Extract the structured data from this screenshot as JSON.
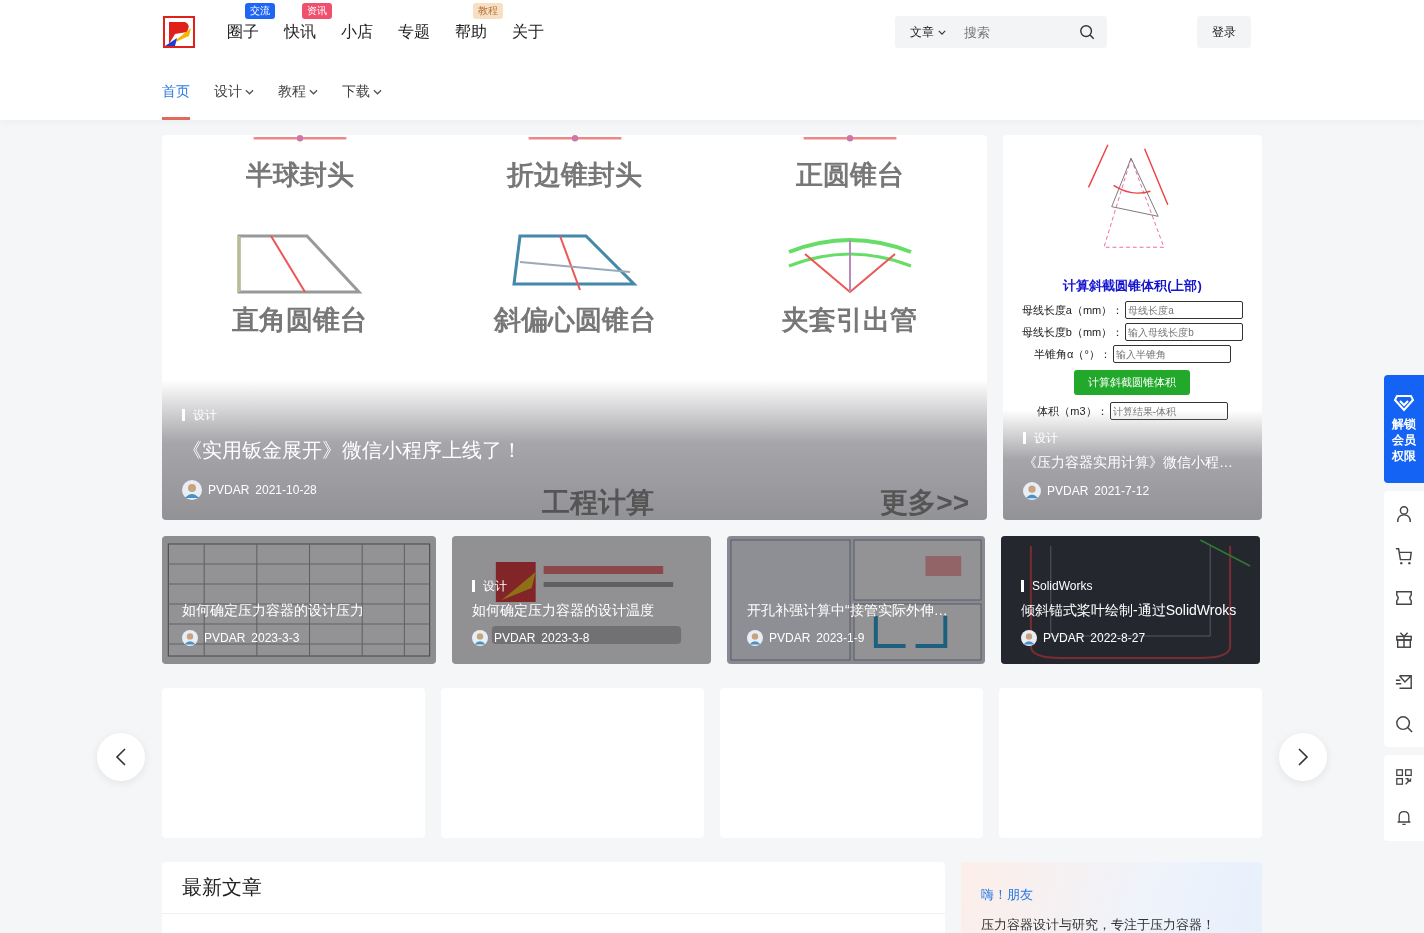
{
  "header": {
    "nav": [
      {
        "label": "圈子",
        "badge": {
          "text": "交流",
          "kind": "solid",
          "color": "#2066f5"
        }
      },
      {
        "label": "快讯",
        "badge": {
          "text": "资讯",
          "kind": "solid",
          "color": "#f0506e"
        }
      },
      {
        "label": "小店"
      },
      {
        "label": "专题"
      },
      {
        "label": "帮助",
        "badge": {
          "text": "教程",
          "kind": "soft",
          "color": "#f8dfc3"
        }
      },
      {
        "label": "关于"
      }
    ],
    "search": {
      "scope": "文章",
      "placeholder": "搜索"
    },
    "login": "登录"
  },
  "subnav": [
    {
      "label": "首页",
      "selected": true,
      "has_menu": false
    },
    {
      "label": "设计",
      "selected": false,
      "has_menu": true
    },
    {
      "label": "教程",
      "selected": false,
      "has_menu": true
    },
    {
      "label": "下载",
      "selected": false,
      "has_menu": true
    }
  ],
  "hero": {
    "tiles": [
      {
        "label": "半球封头",
        "kind": "stub"
      },
      {
        "label": "折边锥封头",
        "kind": "stub"
      },
      {
        "label": "正圆锥台",
        "kind": "stub"
      },
      {
        "label": "直角圆锥台",
        "kind": "right"
      },
      {
        "label": "斜偏心圆锥台",
        "kind": "skew"
      },
      {
        "label": "夹套引出管",
        "kind": "arc"
      }
    ],
    "footer_left": "工程计算",
    "footer_right": "更多>>",
    "category": "设计",
    "title": "《实用钣金展开》微信小程序上线了！",
    "author": "PVDAR",
    "date": "2021-10-28"
  },
  "side_post": {
    "form": {
      "title": "计算斜截圆锥体积(上部)",
      "fields": [
        {
          "label": "母线长度a（mm）：",
          "placeholder": "母线长度a"
        },
        {
          "label": "母线长度b（mm）：",
          "placeholder": "输入母线长度b"
        },
        {
          "label": "半锥角α（°）：",
          "placeholder": "输入半锥角"
        }
      ],
      "button": "计算斜截圆锥体积",
      "result": {
        "label": "体积（m3）：",
        "placeholder": "计算结果-体积"
      }
    },
    "category": "设计",
    "title": "《压力容器实用计算》微信小程…",
    "author": "PVDAR",
    "date": "2021-7-12"
  },
  "cards": [
    {
      "kind": "table",
      "title": "如何确定压力容器的设计压力",
      "author": "PVDAR",
      "date": "2023-3-3"
    },
    {
      "kind": "logo",
      "tag": "设计",
      "title": "如何确定压力容器的设计温度",
      "author": "PVDAR",
      "date": "2023-3-8"
    },
    {
      "kind": "form",
      "title": "开孔补强计算中“接管实际外伸…",
      "author": "PVDAR",
      "date": "2023-1-9"
    },
    {
      "kind": "cad",
      "tag": "SolidWorks",
      "title": "倾斜锚式桨叶绘制-通过SolidWroks",
      "author": "PVDAR",
      "date": "2022-8-27"
    }
  ],
  "carousel": {
    "cards": [
      {
        "kind": "blank"
      },
      {
        "kind": "blank"
      },
      {
        "kind": "blank"
      },
      {
        "kind": "blank"
      }
    ]
  },
  "toolbar": {
    "vip": "解锁会员权限"
  },
  "latest": {
    "title": "最新文章"
  },
  "welcome": {
    "greeting": "嗨！朋友",
    "text": "压力容器设计与研究，专注于压力容器！"
  }
}
